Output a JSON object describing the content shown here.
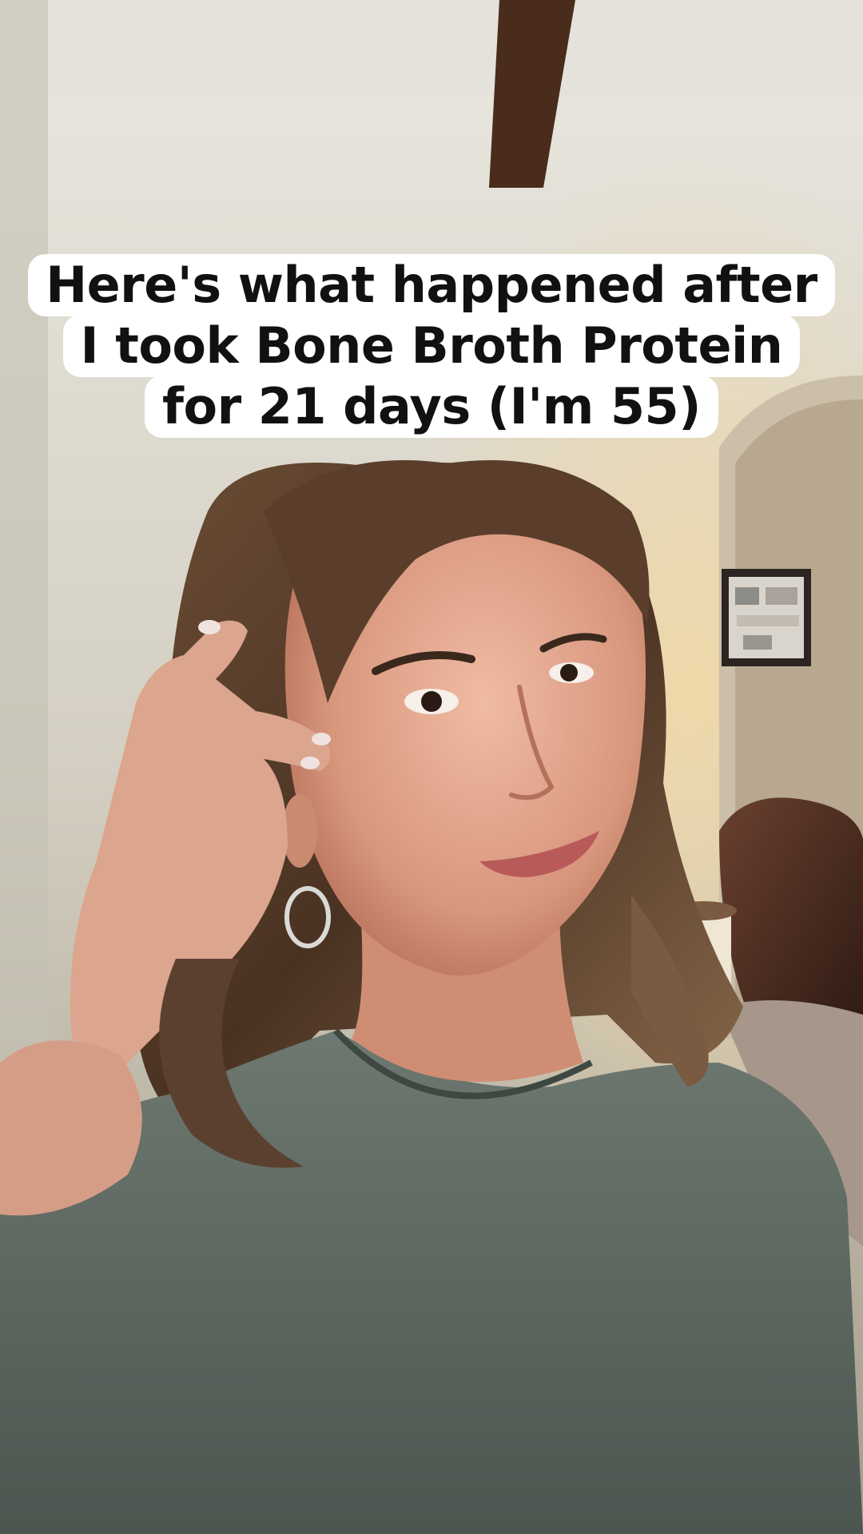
{
  "caption": {
    "lines": [
      "Here's what happened after",
      "I took Bone Broth Protein",
      "for 21 days (I'm 55)"
    ]
  },
  "colors": {
    "caption_background": "#ffffff",
    "caption_text": "#111111",
    "wall": "#d8d4c8",
    "ceiling_beam": "#4a2c1c",
    "shirt": "#5f6a62",
    "hair": "#4a3424",
    "skin": "#d8a08a"
  }
}
